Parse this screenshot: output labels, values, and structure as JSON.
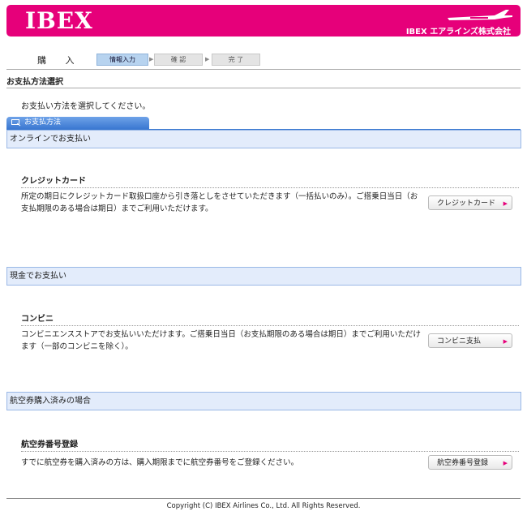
{
  "header": {
    "logo_text": "IBEX",
    "company_name": "IBEX エアラインズ株式会社",
    "brand_color": "#e6007a"
  },
  "steps": {
    "title": "購 入",
    "items": [
      {
        "label": "情報入力",
        "state": "active"
      },
      {
        "label": "確 認",
        "state": "inactive"
      },
      {
        "label": "完 了",
        "state": "inactive"
      }
    ]
  },
  "page": {
    "title": "お支払方法選択",
    "intro": "お支払い方法を選択してください。",
    "tab_label": "お支払方法"
  },
  "sections": [
    {
      "heading": "オンラインでお支払い",
      "method_title": "クレジットカード",
      "description": "所定の期日にクレジットカード取扱口座から引き落としをさせていただきます（一括払いのみ）。ご搭乗日当日（お支払期限のある場合は期日）までご利用いただけます。",
      "button_label": "クレジットカード"
    },
    {
      "heading": "現金でお支払い",
      "method_title": "コンビニ",
      "description": "コンビニエンスストアでお支払いいただけます。ご搭乗日当日（お支払期限のある場合は期日）までご利用いただけます（一部のコンビニを除く）。",
      "button_label": "コンビニ支払"
    },
    {
      "heading": "航空券購入済みの場合",
      "method_title": "航空券番号登録",
      "description": "すでに航空券を購入済みの方は、購入期限までに航空券番号をご登録ください。",
      "button_label": "航空券番号登録"
    }
  ],
  "footer": {
    "copyright": "Copyright (C) IBEX Airlines Co., Ltd. All Rights Reserved."
  }
}
